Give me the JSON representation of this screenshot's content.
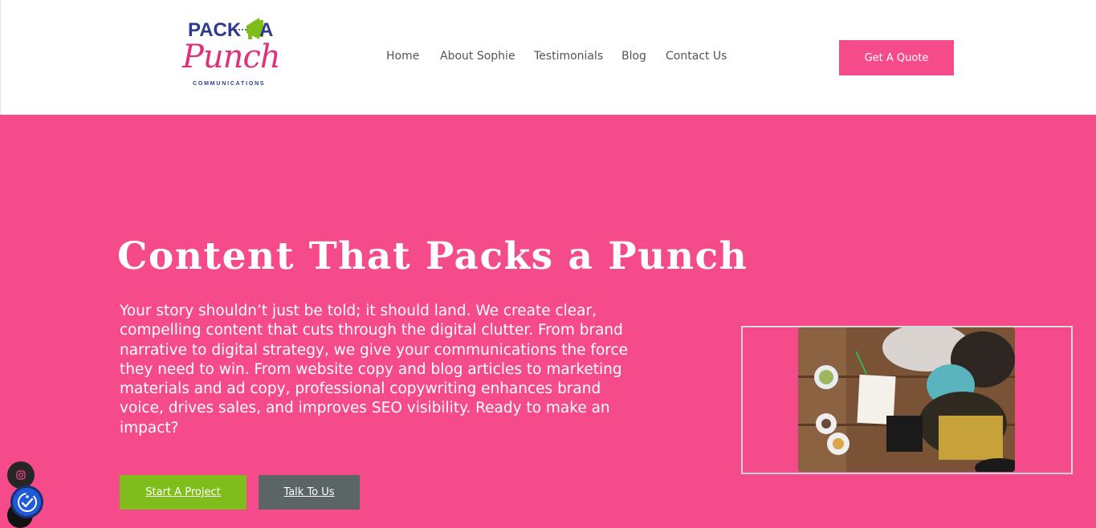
{
  "header": {
    "logo": {
      "line1_left": "PACK",
      "line1_right": "A",
      "line2": "Punch",
      "line3": "COMMUNICATIONS",
      "icon": "megaphone-icon"
    },
    "nav": [
      {
        "label": "Home"
      },
      {
        "label": "About Sophie"
      },
      {
        "label": "Testimonials"
      },
      {
        "label": "Blog"
      },
      {
        "label": "Contact Us"
      }
    ],
    "cta_label": "Get A Quote"
  },
  "hero": {
    "title": "Content That Packs a Punch",
    "body": "Your story shouldn’t just be told; it should land. We create clear, compelling content that cuts through the digital clutter. From brand narrative to digital strategy, we give your communications the force they need to win. From website copy and blog articles to marketing materials and ad copy, professional copywriting enhances brand voice, drives sales, and improves SEO visibility. Ready to make an impact?",
    "primary_button": "Start A Project",
    "secondary_button": "Talk To Us"
  },
  "widgets": {
    "instagram_icon": "instagram-icon",
    "accessibility_icon": "accessibility-check-icon"
  },
  "colors": {
    "brand_pink": "#f54b8b",
    "brand_navy": "#2d3b8f",
    "green": "#7fbd1c",
    "slate": "#5b6566"
  }
}
